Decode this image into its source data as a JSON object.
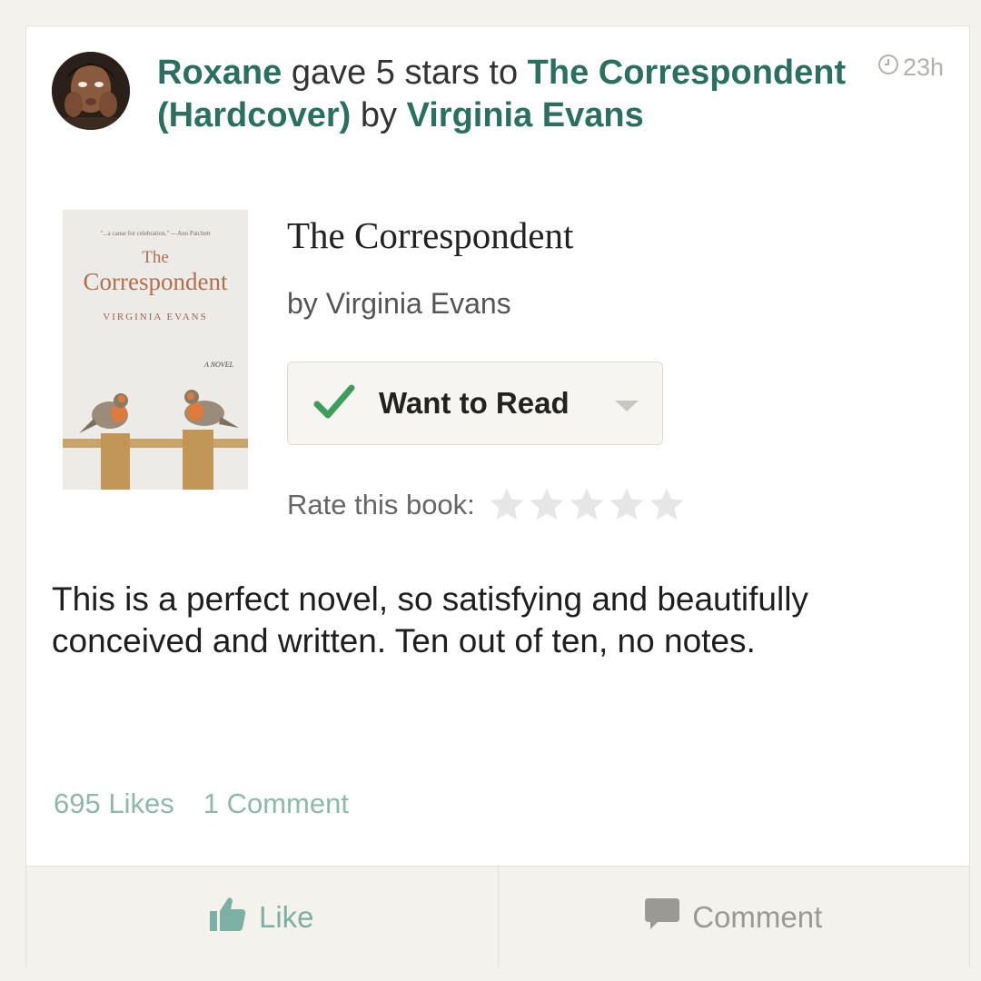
{
  "post": {
    "user_name": "Roxane",
    "verb": "gave 5 stars to",
    "book_link": "The Correspondent (Hardcover)",
    "by_word": "by",
    "author_link": "Virginia Evans",
    "time_ago": "23h"
  },
  "cover": {
    "blurb": "\"...a cause for celebration.\" —Ann Patchett",
    "title_line1": "The",
    "title_line2": "Correspondent",
    "author": "VIRGINIA EVANS",
    "tag": "A NOVEL"
  },
  "book": {
    "title": "The Correspondent",
    "author_line": "by Virginia Evans"
  },
  "shelf_button": {
    "label": "Want to Read"
  },
  "rating": {
    "label": "Rate this book:",
    "max_stars": 5,
    "current": 0
  },
  "review": {
    "text": "This is a perfect novel, so satisfying and beautifully conceived and written. Ten out of ten, no notes."
  },
  "stats": {
    "likes": "695 Likes",
    "comments": "1 Comment"
  },
  "actions": {
    "like_label": "Like",
    "comment_label": "Comment"
  },
  "colors": {
    "link": "#2a6f5f",
    "check": "#3f9d5b",
    "muted_teal": "#8fb8ad",
    "star_empty": "#e6e6e6"
  },
  "icons": {
    "clock": "clock-icon",
    "check": "checkmark-icon",
    "caret": "caret-down-icon",
    "star": "star-icon",
    "like": "thumbs-up-icon",
    "comment": "speech-bubble-icon"
  }
}
